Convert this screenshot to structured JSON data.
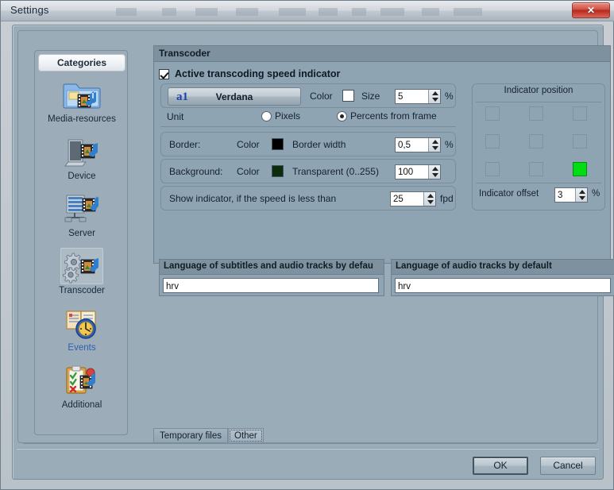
{
  "window": {
    "title": "Settings",
    "close_label": "✕"
  },
  "sidebar": {
    "header": "Categories",
    "items": [
      {
        "label": "Media-resources",
        "icon": "folder-media-icon",
        "state": "normal"
      },
      {
        "label": "Device",
        "icon": "device-media-icon",
        "state": "normal"
      },
      {
        "label": "Server",
        "icon": "server-media-icon",
        "state": "normal"
      },
      {
        "label": "Transcoder",
        "icon": "gears-media-icon",
        "state": "selected"
      },
      {
        "label": "Events",
        "icon": "book-clock-icon",
        "state": "hovered"
      },
      {
        "label": "Additional",
        "icon": "clipboard-media-icon",
        "state": "normal"
      }
    ]
  },
  "main": {
    "group_title": "Transcoder",
    "active_checkbox": {
      "label": "Active transcoding speed indicator",
      "checked": true
    },
    "font_row": {
      "font_icon": "a1",
      "font_name": "Verdana",
      "color_label": "Color",
      "color_value": "#ffffff",
      "size_label": "Size",
      "size_value": "5",
      "size_unit": "%"
    },
    "unit_row": {
      "label": "Unit",
      "options": [
        {
          "label": "Pixels",
          "selected": false
        },
        {
          "label": "Percents from frame",
          "selected": true
        }
      ]
    },
    "border_row": {
      "label": "Border:",
      "color_label": "Color",
      "color_value": "#000000",
      "width_label": "Border width",
      "width_value": "0,5",
      "width_unit": "%"
    },
    "background_row": {
      "label": "Background:",
      "color_label": "Color",
      "color_value": "#0b2d0b",
      "transparent_label": "Transparent (0..255)",
      "transparent_value": "100"
    },
    "speed_row": {
      "label": "Show indicator, if the speed is less than",
      "value": "25",
      "unit": "fpd"
    },
    "indicator_position": {
      "title": "Indicator position",
      "cells": [
        {
          "id": "top-left",
          "selected": false
        },
        {
          "id": "top-center",
          "selected": false
        },
        {
          "id": "top-right",
          "selected": false
        },
        {
          "id": "middle-left",
          "selected": false
        },
        {
          "id": "middle-center",
          "selected": false
        },
        {
          "id": "middle-right",
          "selected": false
        },
        {
          "id": "bottom-left",
          "selected": false
        },
        {
          "id": "bottom-center",
          "selected": false
        },
        {
          "id": "bottom-right",
          "selected": true
        }
      ],
      "selected_color": "#00dd11",
      "offset_label": "Indicator offset",
      "offset_value": "3",
      "offset_unit": "%"
    },
    "language_subtitles": {
      "header": "Language of subtitles and audio tracks by defau",
      "value": "hrv"
    },
    "language_audio": {
      "header": "Language of audio tracks by default",
      "value": "hrv"
    }
  },
  "tabs": [
    {
      "label": "Temporary files",
      "active": false
    },
    {
      "label": "Other",
      "active": true
    }
  ],
  "footer": {
    "ok_label": "OK",
    "cancel_label": "Cancel"
  }
}
